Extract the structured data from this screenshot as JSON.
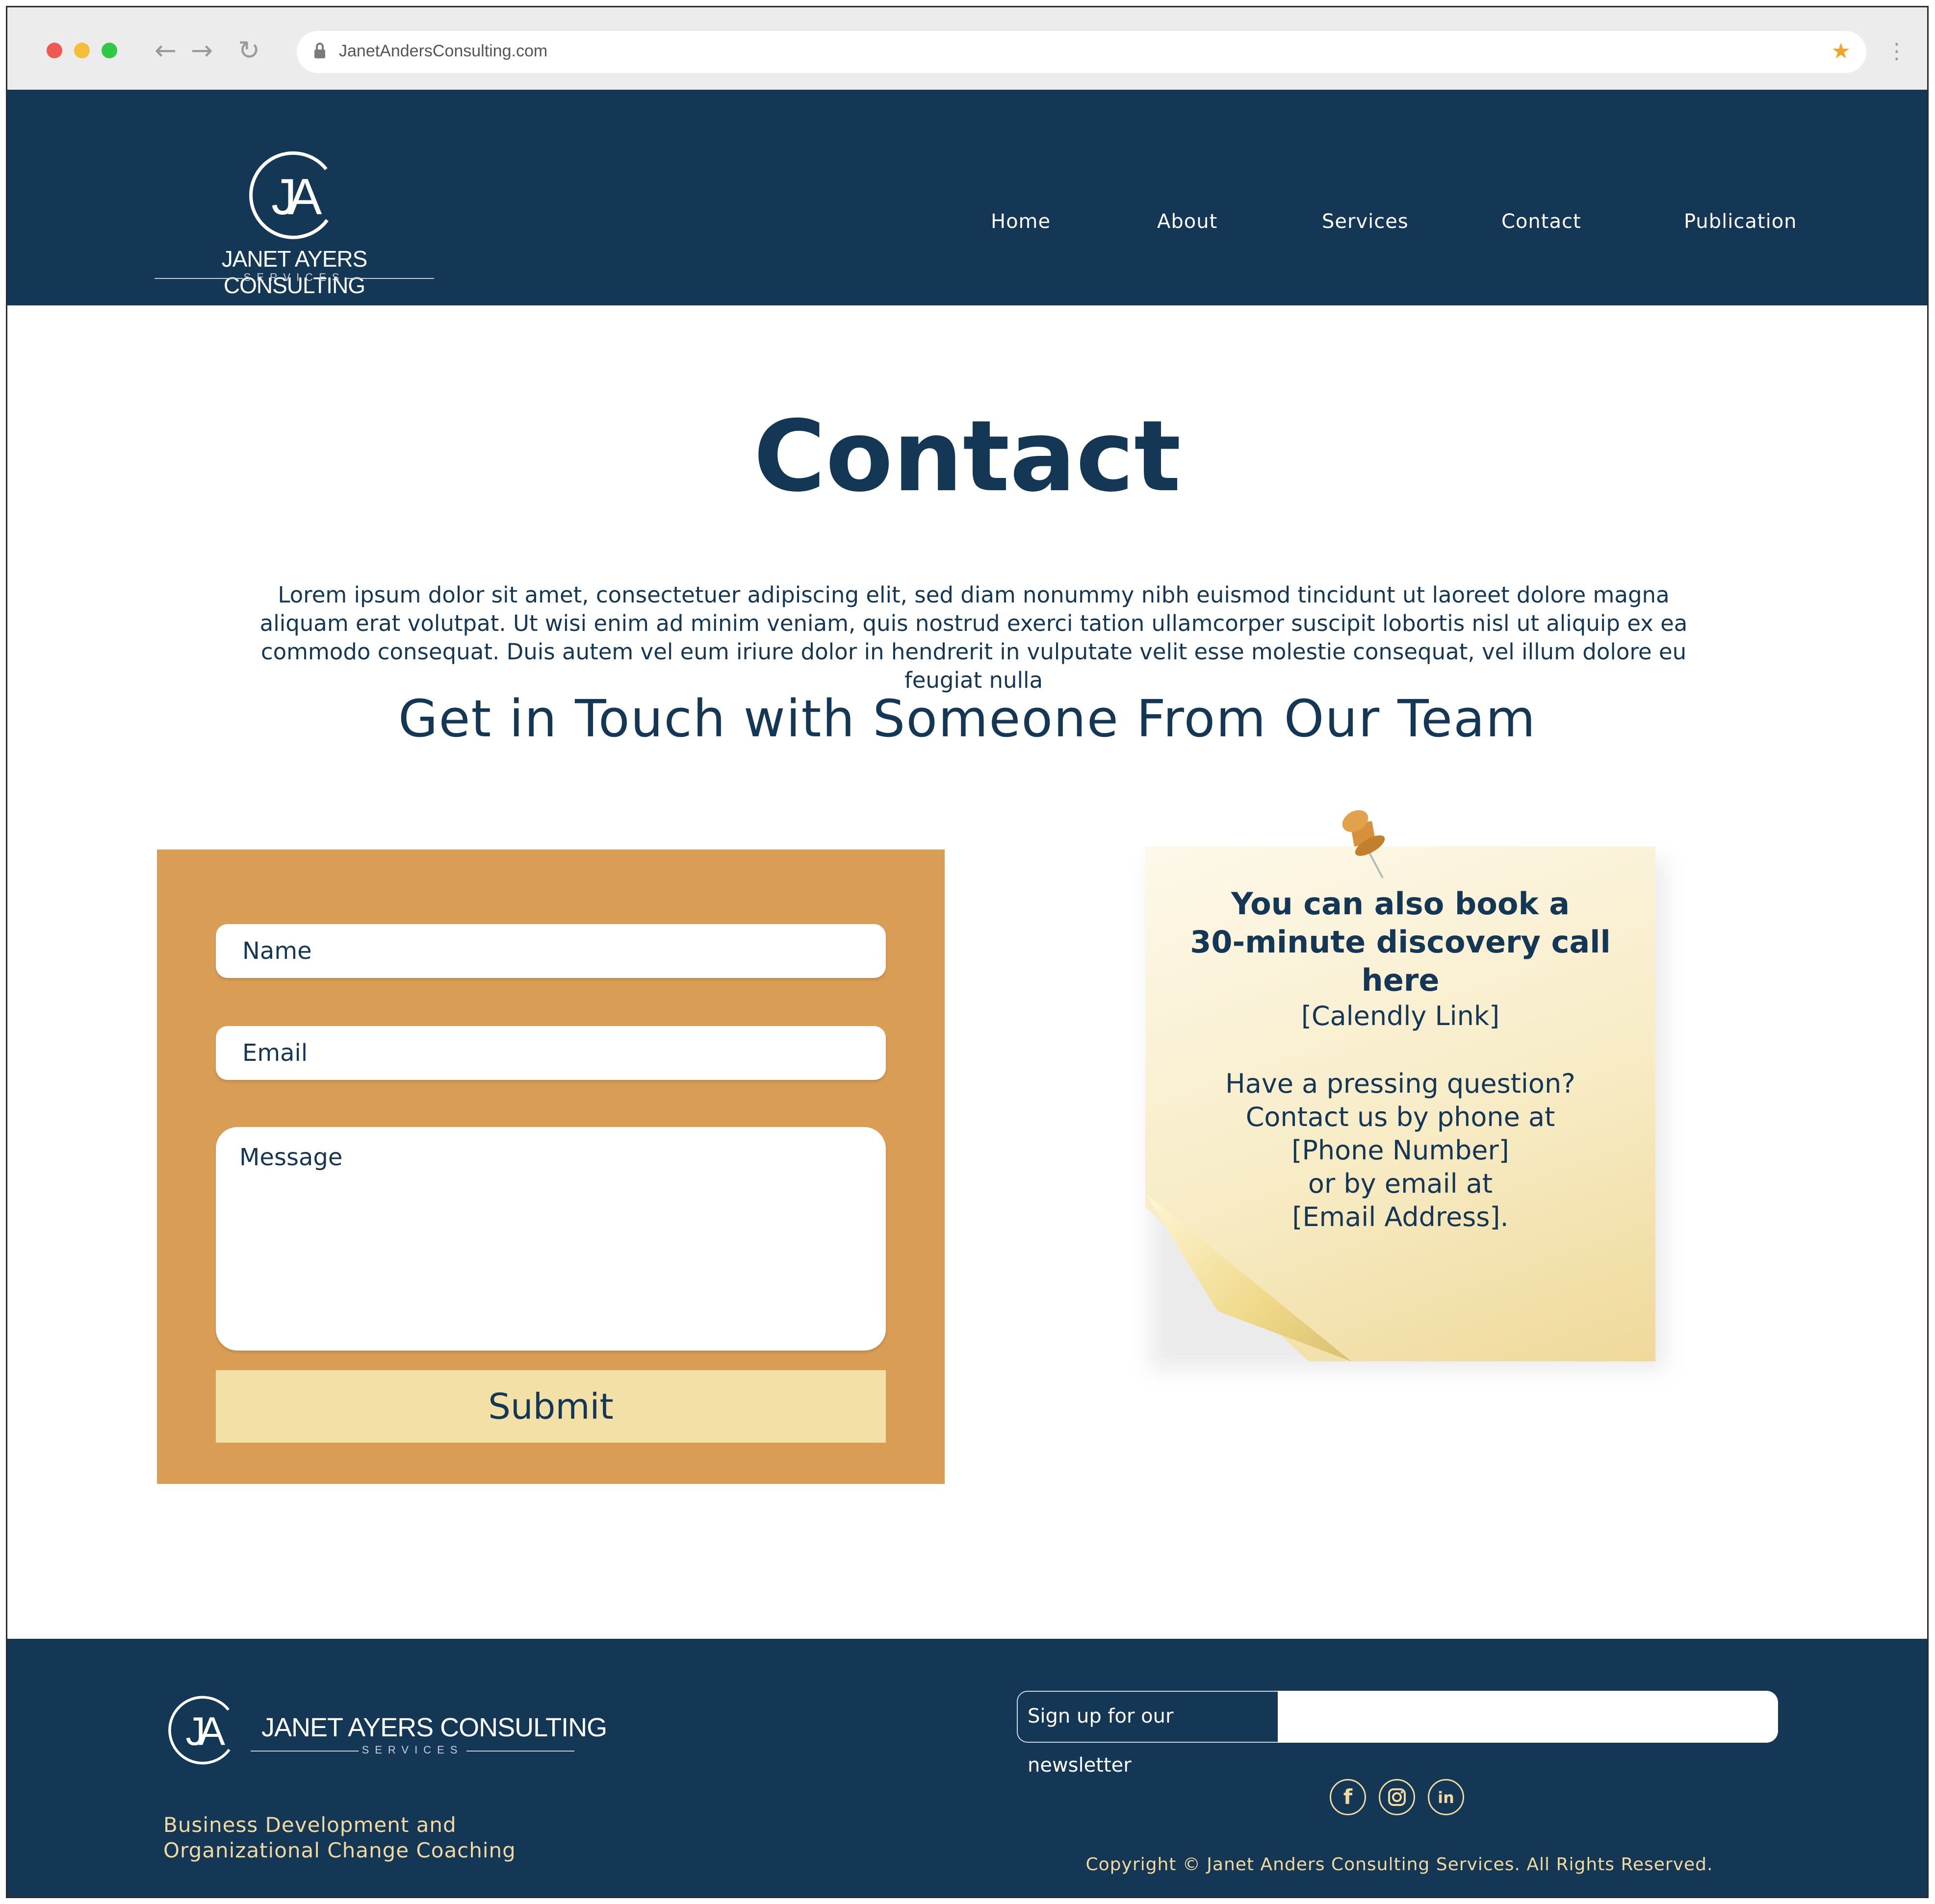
{
  "browser": {
    "url": "JanetAndersConsulting.com"
  },
  "colors": {
    "navy": "#143756",
    "orange": "#d99d55",
    "cream": "#f3e0a6",
    "gold_text": "#f1d9a0"
  },
  "header": {
    "logo_monogram": "JA",
    "brand": "JANET AYERS CONSULTING",
    "brand_sub": "SERVICES",
    "nav": [
      "Home",
      "About",
      "Services",
      "Contact",
      "Publication"
    ]
  },
  "main": {
    "title": "Contact",
    "intro": "Lorem ipsum dolor sit amet, consectetuer adipiscing elit, sed diam nonummy nibh euismod tincidunt ut laoreet dolore magna aliquam erat volutpat. Ut wisi enim ad minim veniam, quis nostrud exerci tation ullamcorper suscipit lobortis nisl ut aliquip ex ea commodo consequat. Duis autem vel eum iriure dolor in hendrerit in vulputate velit esse molestie consequat, vel illum dolore eu feugiat nulla",
    "subtitle": "Get in Touch with Someone From Our Team"
  },
  "form": {
    "name_placeholder": "Name",
    "email_placeholder": "Email",
    "message_placeholder": "Message",
    "submit_label": "Submit"
  },
  "note": {
    "line1": "You can also book a",
    "line2": "30-minute discovery call",
    "line3": "here",
    "calendly": "[Calendly Link]",
    "q1": "Have a pressing question?",
    "q2": "Contact us by phone at",
    "q3": "[Phone Number]",
    "q4": "or by email at",
    "q5": "[Email Address]."
  },
  "footer": {
    "brand": "JANET AYERS CONSULTING",
    "brand_sub": "SERVICES",
    "tagline_1": "Business Development and",
    "tagline_2": "Organizational Change Coaching",
    "newsletter_label": "Sign up for our newsletter",
    "social": [
      "facebook-icon",
      "instagram-icon",
      "linkedin-icon"
    ],
    "copyright": "Copyright © Janet Anders Consulting Services. All Rights Reserved."
  }
}
